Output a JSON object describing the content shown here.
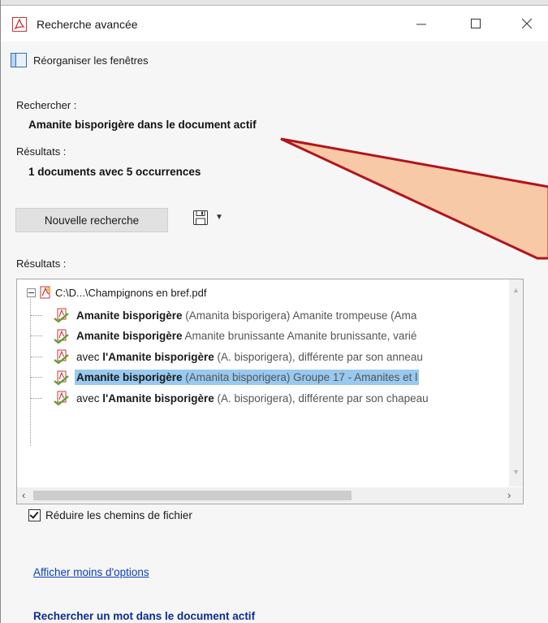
{
  "window": {
    "title": "Recherche avancée"
  },
  "toolbar": {
    "reorganize_label": "Réorganiser les fenêtres"
  },
  "search": {
    "query_label": "Rechercher :",
    "query_value": "Amanite bisporigère dans le document actif",
    "results_label": "Résultats :",
    "results_summary": "1 documents avec 5 occurrences",
    "new_search_label": "Nouvelle recherche"
  },
  "results": {
    "label": "Résultats :",
    "root_path": "C:\\D...\\Champignons en bref.pdf",
    "items": [
      {
        "prefix": "",
        "bold": "Amanite bisporigère",
        "rest": " (Amanita bisporigera) Amanite trompeuse (Ama"
      },
      {
        "prefix": "",
        "bold": "Amanite bisporigère",
        "rest": " Amanite brunissante Amanite brunissante, varié"
      },
      {
        "prefix": "avec ",
        "bold": "l'Amanite bisporigère",
        "rest": " (A. bisporigera), différente par son anneau"
      },
      {
        "prefix": "",
        "bold": "Amanite bisporigère",
        "rest": " (Amanita bisporigera) Groupe 17 - Amanites et l"
      },
      {
        "prefix": "avec ",
        "bold": "l'Amanite bisporigère",
        "rest": " (A. bisporigera), différente par son chapeau"
      }
    ],
    "selected_index": 3
  },
  "options": {
    "shorten_paths_label": "Réduire les chemins de fichier",
    "shorten_paths_checked": true,
    "show_less_link": "Afficher moins d'options",
    "search_word_link": "Rechercher un mot dans le document actif"
  },
  "icons": {
    "app": "acrobat-pdf-icon",
    "reorganize": "window-layout-icon",
    "save": "floppy-disk-icon",
    "hit": "pdf-hit-icon"
  },
  "colors": {
    "selection": "#99c9ef",
    "link": "#0b3dbd",
    "callout_fill": "#f8c9a6",
    "callout_stroke": "#b3141a"
  }
}
